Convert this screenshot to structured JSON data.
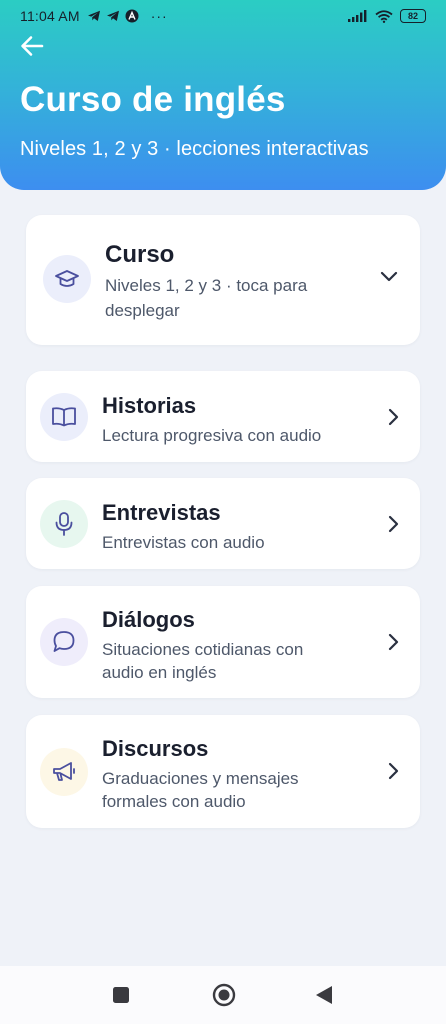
{
  "status_bar": {
    "time": "11:04 AM",
    "more": "···",
    "battery": "82",
    "icons": [
      "telegram-icon",
      "telegram-icon",
      "app-notification-icon",
      "signal-icon",
      "wifi-icon",
      "battery-icon"
    ]
  },
  "header": {
    "title": "Curso de inglés",
    "subtitle": "Niveles 1, 2 y 3 · lecciones interactivas",
    "back_icon": "arrow-left-icon"
  },
  "sections": [
    {
      "title": "Curso",
      "subtitle_lines": [
        "Niveles 1, 2 y 3 · toca para",
        "desplegar"
      ],
      "icon": "graduation-cap-icon",
      "icon_bg": "#ebeefb",
      "icon_color": "#4a4f9e",
      "chevron": "chevron-down-icon"
    },
    {
      "title": "Historias",
      "subtitle_lines": [
        "Lectura progresiva con audio"
      ],
      "icon": "book-open-icon",
      "icon_bg": "#ebeefb",
      "icon_color": "#4a4f9e",
      "chevron": "chevron-right-icon"
    },
    {
      "title": "Entrevistas",
      "subtitle_lines": [
        "Entrevistas con audio"
      ],
      "icon": "microphone-icon",
      "icon_bg": "#e7f7ef",
      "icon_color": "#4a4f9e",
      "chevron": "chevron-right-icon"
    },
    {
      "title": "Diálogos",
      "subtitle_lines": [
        "Situaciones cotidianas con",
        "audio en inglés"
      ],
      "icon": "chat-bubble-icon",
      "icon_bg": "#efedfb",
      "icon_color": "#4a4f9e",
      "chevron": "chevron-right-icon"
    },
    {
      "title": "Discursos",
      "subtitle_lines": [
        "Graduaciones y mensajes",
        "formales con audio"
      ],
      "icon": "megaphone-icon",
      "icon_bg": "#fdf7e6",
      "icon_color": "#4a4f9e",
      "chevron": "chevron-right-icon"
    }
  ],
  "nav_bar": {
    "buttons": [
      "recent-apps-icon",
      "home-icon",
      "back-icon"
    ]
  },
  "colors": {
    "header_gradient_top": "#2bcdc3",
    "header_gradient_bottom": "#3d8ef0",
    "page_background": "#eff2f8",
    "card_background": "#ffffff",
    "title_text": "#1a1f2e",
    "subtitle_text": "#4e586a"
  }
}
